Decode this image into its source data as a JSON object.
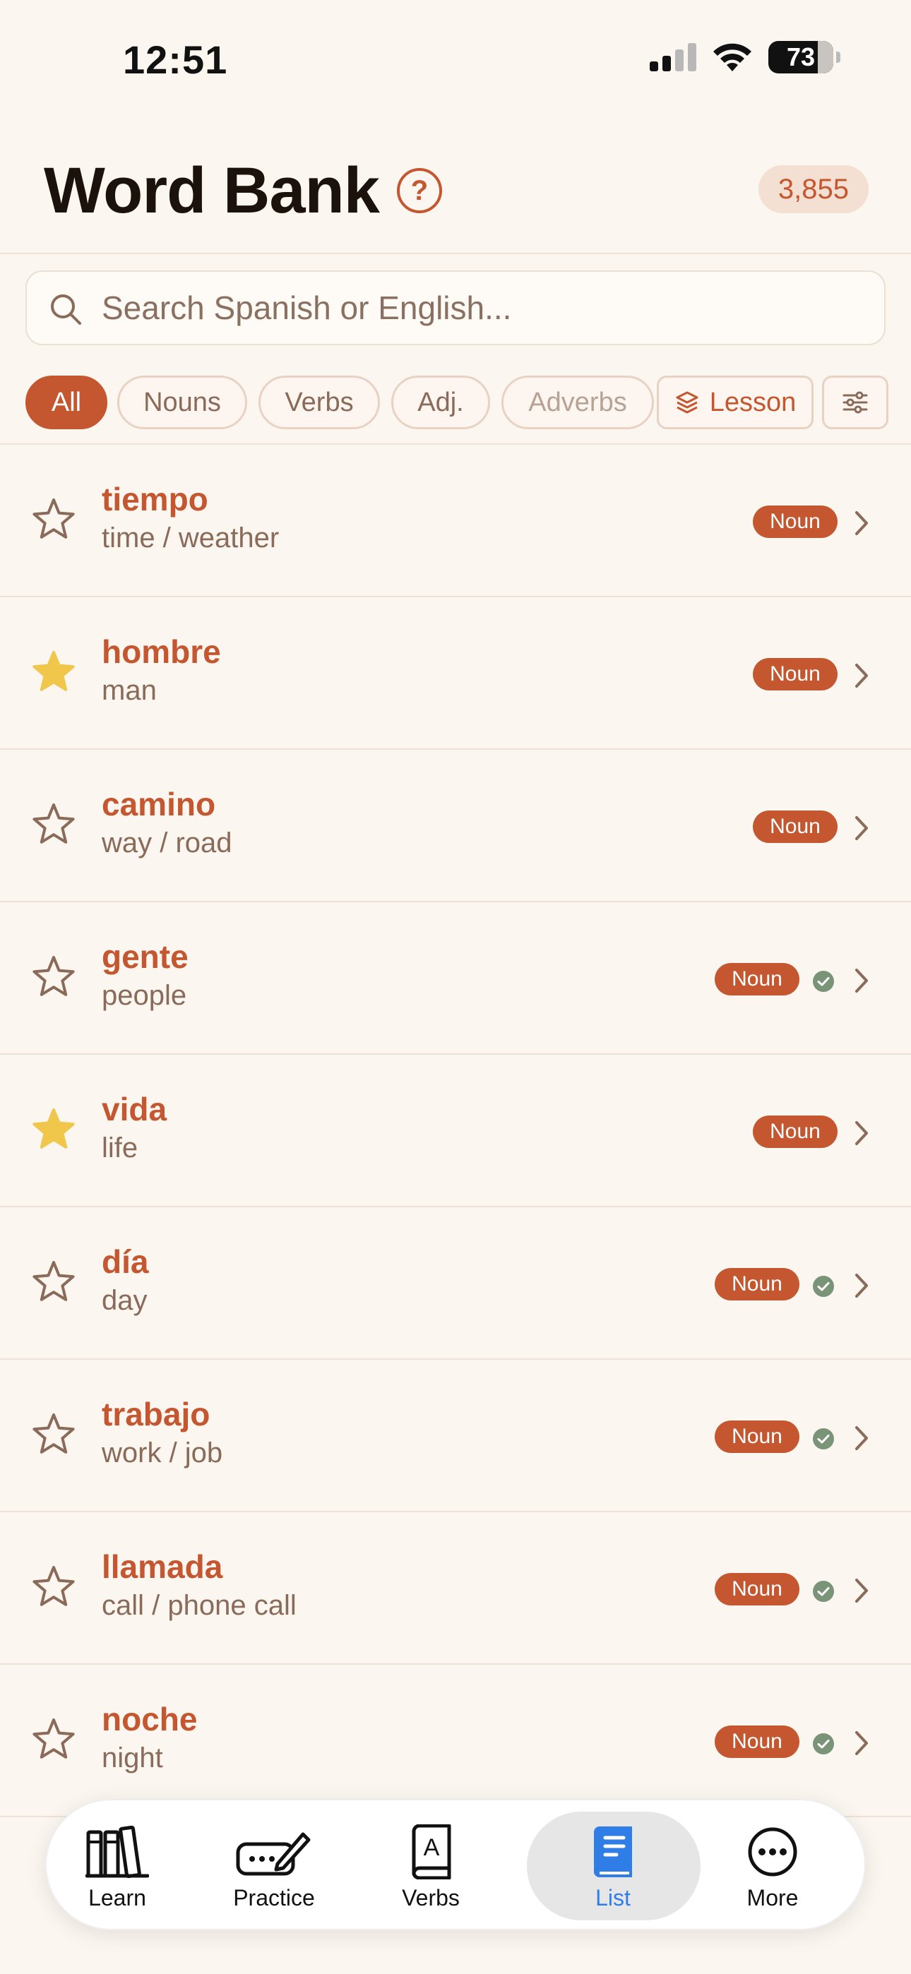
{
  "status": {
    "time": "12:51",
    "battery": "73"
  },
  "header": {
    "title": "Word Bank",
    "help": "?",
    "count": "3,855"
  },
  "search": {
    "placeholder": "Search Spanish or English..."
  },
  "filters": {
    "chips": [
      "All",
      "Nouns",
      "Verbs",
      "Adj.",
      "Adverbs"
    ],
    "lesson": "Lesson"
  },
  "words": [
    {
      "word": "tiempo",
      "translation": "time / weather",
      "pos": "Noun",
      "starred": false,
      "learned": false
    },
    {
      "word": "hombre",
      "translation": "man",
      "pos": "Noun",
      "starred": true,
      "learned": false
    },
    {
      "word": "camino",
      "translation": "way / road",
      "pos": "Noun",
      "starred": false,
      "learned": false
    },
    {
      "word": "gente",
      "translation": "people",
      "pos": "Noun",
      "starred": false,
      "learned": true
    },
    {
      "word": "vida",
      "translation": "life",
      "pos": "Noun",
      "starred": true,
      "learned": false
    },
    {
      "word": "día",
      "translation": "day",
      "pos": "Noun",
      "starred": false,
      "learned": true
    },
    {
      "word": "trabajo",
      "translation": "work / job",
      "pos": "Noun",
      "starred": false,
      "learned": true
    },
    {
      "word": "llamada",
      "translation": "call / phone call",
      "pos": "Noun",
      "starred": false,
      "learned": true
    },
    {
      "word": "noche",
      "translation": "night",
      "pos": "Noun",
      "starred": false,
      "learned": true
    }
  ],
  "tabs": [
    "Learn",
    "Practice",
    "Verbs",
    "List",
    "More"
  ],
  "colors": {
    "accent": "#c4572f",
    "background": "#fbf6f0",
    "star": "#f0c74a",
    "check": "#7a9478",
    "tab_active": "#2f7ee8"
  }
}
